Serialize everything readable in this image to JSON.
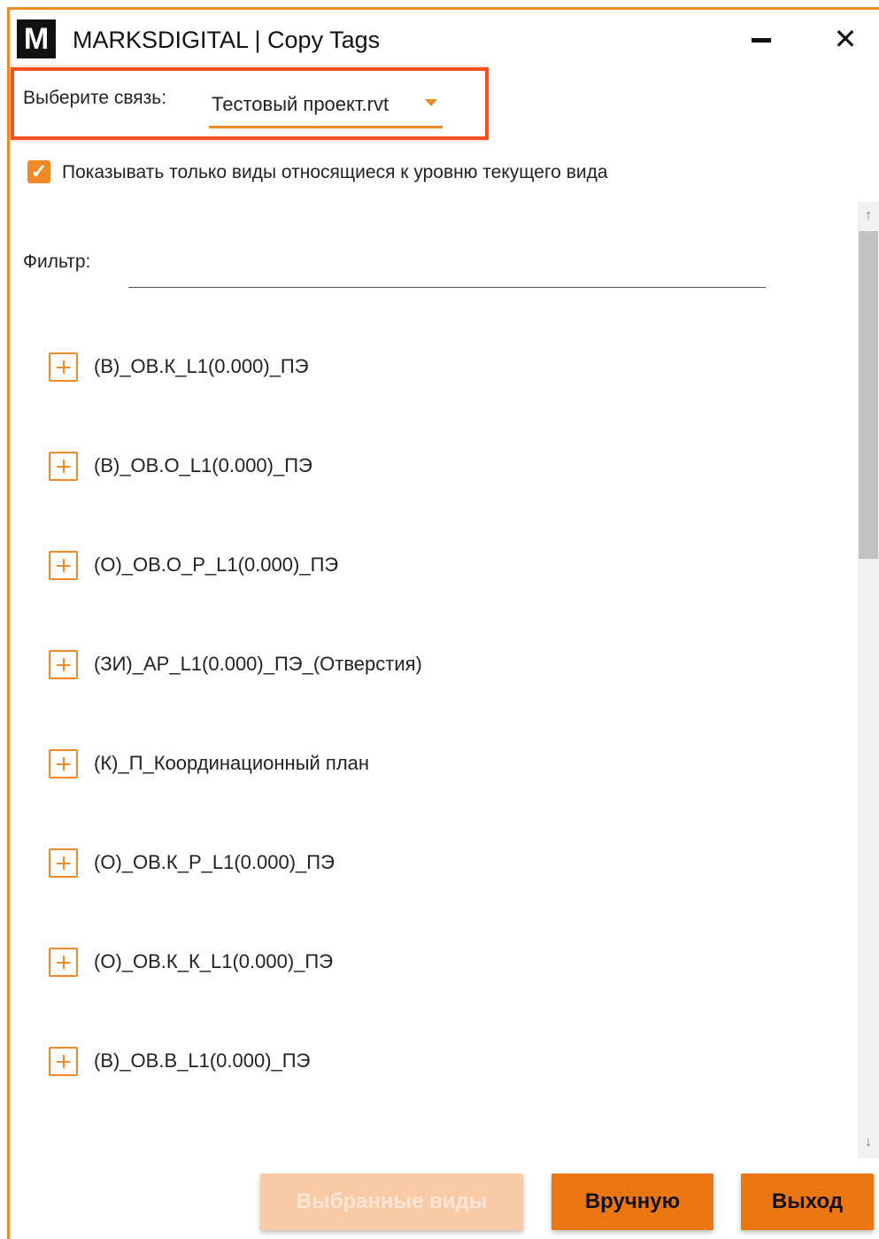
{
  "window": {
    "logo_letter": "M",
    "title": "MARKSDIGITAL | Copy Tags",
    "minimize_icon": "minimize-icon",
    "close_glyph": "✕"
  },
  "link_selector": {
    "label": "Выберите связь:",
    "value": "Тестовый проект.rvt"
  },
  "filter_option": {
    "checked": true,
    "label": "Показывать только виды относящиеся к уровню текущего вида"
  },
  "filter": {
    "label": "Фильтр:",
    "value": ""
  },
  "views": [
    {
      "label": "(В)_ОВ.К_L1(0.000)_ПЭ"
    },
    {
      "label": "(В)_ОВ.О_L1(0.000)_ПЭ"
    },
    {
      "label": "(О)_ОВ.О_Р_L1(0.000)_ПЭ"
    },
    {
      "label": "(ЗИ)_АР_L1(0.000)_ПЭ_(Отверстия)"
    },
    {
      "label": "(К)_П_Координационный план"
    },
    {
      "label": "(О)_ОВ.К_Р_L1(0.000)_ПЭ"
    },
    {
      "label": "(О)_ОВ.К_К_L1(0.000)_ПЭ"
    },
    {
      "label": "(В)_ОВ.В_L1(0.000)_ПЭ"
    }
  ],
  "buttons": {
    "selected_views": "Выбранные виды",
    "manual": "Вручную",
    "exit": "Выход"
  },
  "colors": {
    "accent": "#f08a24",
    "highlight_border": "#f4511e",
    "button": "#ea7711",
    "button_disabled": "#f8cba6"
  }
}
